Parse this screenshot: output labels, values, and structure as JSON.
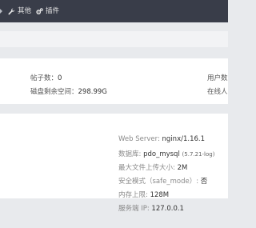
{
  "topnav": {
    "items": [
      {
        "label": "其他",
        "icon": "wrench-icon"
      },
      {
        "label": "插件",
        "icon": "gears-icon"
      }
    ]
  },
  "stats": {
    "posts_label": "帖子数：",
    "posts_value": "0",
    "disk_label": "磁盘剩余空间：",
    "disk_value": "298.99G",
    "users_label": "用户数",
    "online_label": "在线人"
  },
  "server": {
    "web_server_label": "Web Server: ",
    "web_server_value": "nginx/1.16.1",
    "db_label": "数据库: ",
    "db_value": "pdo_mysql",
    "db_version": "(5.7.21-log)",
    "upload_label": "最大文件上传大小: ",
    "upload_value": "2M",
    "safe_mode_label": "安全模式（safe_mode）: ",
    "safe_mode_value": "否",
    "memory_label": "内存上限: ",
    "memory_value": "128M",
    "ip_label": "服务端 IP: ",
    "ip_value": "127.0.0.1"
  }
}
